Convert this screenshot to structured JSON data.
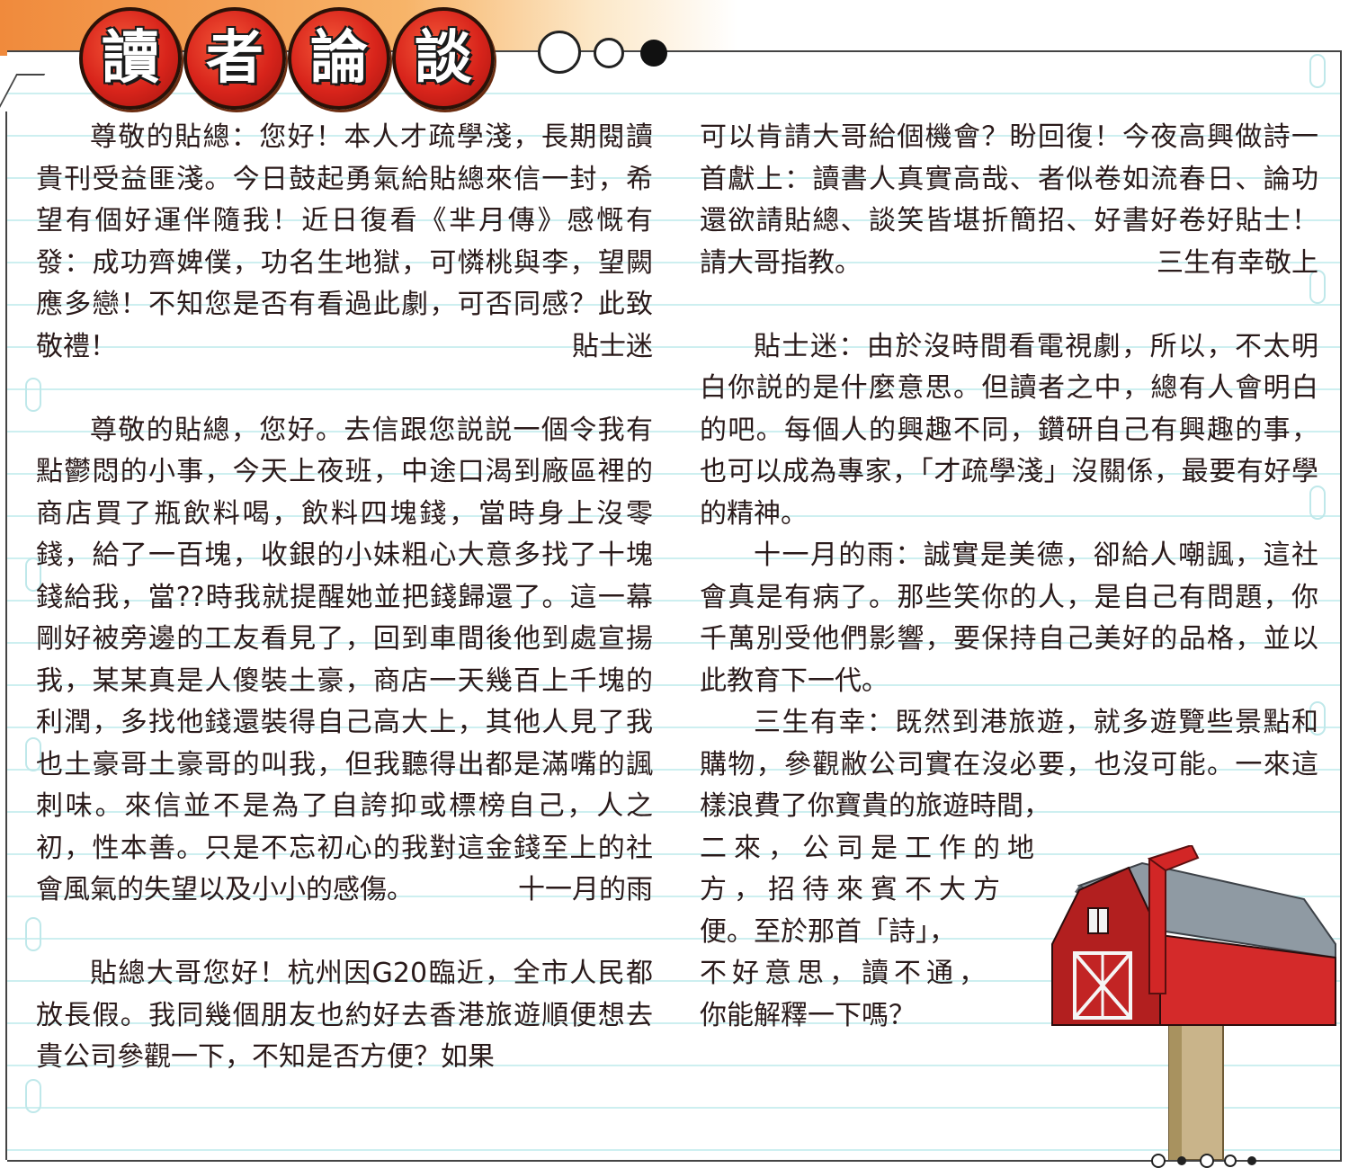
{
  "header": {
    "title_chars": [
      "讀",
      "者",
      "論",
      "談"
    ]
  },
  "colors": {
    "badge_red": "#d8241b",
    "band_orange": "#f08a3c",
    "rule_cyan": "#cdeff0",
    "mailbox_red": "#d42a2a"
  },
  "left_column": {
    "letter1": {
      "body": "尊敬的貼總：您好！本人才疏學淺，長期閱讀貴刊受益匪淺。今日鼓起勇氣給貼總來信一封，希望有個好運伴隨我！近日復看《芈月傳》感慨有發：成功齊婢僕，功名生地獄，可憐桃與李，望闕應多戀！不知您是否有看過此劇，可否同感？此致敬禮！",
      "signature": "貼士迷"
    },
    "letter2": {
      "body": "尊敬的貼總，您好。去信跟您説説一個令我有點鬱悶的小事，今天上夜班，中途口渴到廠區裡的商店買了瓶飲料喝，飲料四塊錢，當時身上沒零錢，給了一百塊，收銀的小妹粗心大意多找了十塊錢給我，當??時我就提醒她並把錢歸還了。這一幕剛好被旁邊的工友看見了，回到車間後他到處宣揚我，某某真是人傻裝土豪，商店一天幾百上千塊的利潤，多找他錢還裝得自己高大上，其他人見了我也土豪哥土豪哥的叫我，但我聽得出都是滿嘴的諷刺味。來信並不是為了自誇抑或標榜自己，人之初，性本善。只是不忘初心的我對這金錢至上的社會風氣的失望以及小小的感傷。",
      "signature": "十一月的雨"
    },
    "letter3_start": "貼總大哥您好！杭州因G20臨近，全市人民都放長假。我同幾個朋友也約好去香港旅遊順便想去貴公司參觀一下，不知是否方便？如果"
  },
  "right_column": {
    "letter3_end": {
      "body": "可以肯請大哥給個機會？盼回復！今夜高興做詩一首獻上：讀書人真實高哉、者似卷如流春日、論功還欲請貼總、談笑皆堪折簡招、好書好卷好貼士！請大哥指教。",
      "signature": "三生有幸敬上"
    },
    "reply1": "貼士迷：由於沒時間看電視劇，所以，不太明白你説的是什麼意思。但讀者之中，總有人會明白的吧。每個人的興趣不同，鑽研自己有興趣的事，也可以成為專家，「才疏學淺」沒關係，最要有好學的精神。",
    "reply2": "十一月的雨：誠實是美德，卻給人嘲諷，這社會真是有病了。那些笑你的人，是自己有問題，你千萬別受他們影響，要保持自己美好的品格，並以此教育下一代。",
    "reply3_full_lines": "三生有幸：既然到港旅遊，就多遊覽些景點和購物，參觀敝公司實在沒必要，也沒可能。一來這樣浪費了你寶貴的旅遊時間，",
    "reply3_short_lines": [
      "二來，公司是工作的地",
      "方，招待來賓不大方",
      "便。至於那首「詩」，",
      "不好意思，讀不通，",
      "你能解釋一下嗎？"
    ]
  },
  "illustration": {
    "icon": "mailbox-icon"
  }
}
